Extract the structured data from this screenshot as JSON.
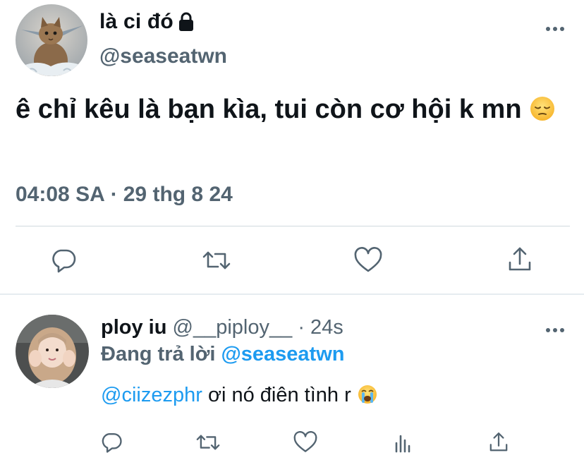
{
  "main_tweet": {
    "display_name": "là ci đó",
    "protected_icon": "lock-icon",
    "handle": "@seaseatwn",
    "text": "ê chỉ kêu là bạn kìa, tui còn cơ hội k mn",
    "emoji": "pensive-face",
    "time": "04:08 SA",
    "separator": "·",
    "date": "29 thg 8 24",
    "actions": [
      "reply-icon",
      "retweet-icon",
      "like-icon",
      "share-icon"
    ]
  },
  "reply": {
    "display_name": "ploy iu",
    "handle": "@__piploy__",
    "separator": "·",
    "time_ago": "24s",
    "replying_prefix": "Đang trả lời",
    "replying_to": "@seaseatwn",
    "mention": "@ciizezphr",
    "text": "ơi nó điên tình r",
    "emoji": "loudly-crying-face",
    "actions": [
      "reply-icon",
      "retweet-icon",
      "like-icon",
      "analytics-icon",
      "share-icon"
    ]
  },
  "colors": {
    "text": "#0f1419",
    "secondary": "#536471",
    "accent": "#1d9bf0",
    "divider": "#cfd9de"
  }
}
